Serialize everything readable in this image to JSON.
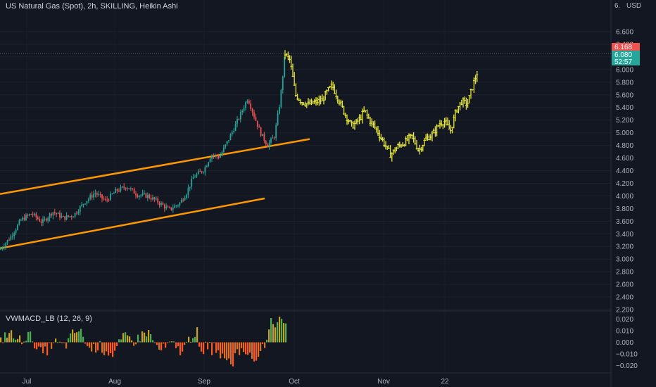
{
  "header": {
    "title": "US Natural Gas (Spot), 2h, SKILLING, Heikin Ashi",
    "currency": "USD",
    "top_price_partial": "6."
  },
  "price_tags": {
    "high": "6.168",
    "last": "6.080",
    "countdown": "52:57"
  },
  "indicator": {
    "label": "VWMACD_LB (12, 26, 9)"
  },
  "x_axis": [
    "Jul",
    "Aug",
    "Sep",
    "Oct",
    "Nov",
    "22"
  ],
  "colors": {
    "background": "#131722",
    "up": "#26a69a",
    "down": "#ef5350",
    "projection": "#e8e83a",
    "channel": "#ff9800",
    "hist_up": "#4caf50",
    "hist_down": "#ff5722",
    "hist_up_dim": "#c9a227",
    "hist_down_dim": "#e07020"
  },
  "chart_data": [
    {
      "type": "line",
      "title": "US Natural Gas (Spot), 2h, SKILLING, Heikin Ashi",
      "y_unit": "USD",
      "ylim": [
        2.2,
        6.6
      ],
      "yticks": [
        2.2,
        2.4,
        2.6,
        2.8,
        3.0,
        3.2,
        3.4,
        3.6,
        3.8,
        4.0,
        4.2,
        4.4,
        4.6,
        4.8,
        5.0,
        5.2,
        5.4,
        5.6,
        5.8,
        6.0,
        6.2,
        6.4,
        6.6
      ],
      "x_tick_labels": [
        "Jul",
        "Aug",
        "Sep",
        "Oct",
        "Nov",
        "22"
      ],
      "series": [
        {
          "kind": "candles",
          "points": [
            [
              0,
              3.15
            ],
            [
              15,
              3.35
            ],
            [
              30,
              3.62
            ],
            [
              45,
              3.72
            ],
            [
              60,
              3.58
            ],
            [
              75,
              3.75
            ],
            [
              90,
              3.65
            ],
            [
              105,
              3.7
            ],
            [
              120,
              3.9
            ],
            [
              135,
              4.05
            ],
            [
              150,
              3.92
            ],
            [
              165,
              4.08
            ],
            [
              180,
              4.15
            ],
            [
              195,
              4.02
            ],
            [
              210,
              4.0
            ],
            [
              225,
              3.9
            ],
            [
              240,
              3.78
            ],
            [
              255,
              3.88
            ],
            [
              265,
              4.05
            ],
            [
              275,
              4.3
            ],
            [
              290,
              4.42
            ],
            [
              300,
              4.65
            ],
            [
              312,
              4.62
            ],
            [
              325,
              4.9
            ],
            [
              340,
              5.25
            ],
            [
              352,
              5.55
            ],
            [
              360,
              5.3
            ],
            [
              370,
              5.0
            ],
            [
              380,
              4.8
            ],
            [
              390,
              4.95
            ],
            [
              398,
              5.5
            ],
            [
              405,
              6.25
            ]
          ]
        },
        {
          "kind": "projection",
          "points": [
            [
              405,
              6.25
            ],
            [
              412,
              6.15
            ],
            [
              420,
              5.6
            ],
            [
              428,
              5.5
            ],
            [
              438,
              5.45
            ],
            [
              448,
              5.48
            ],
            [
              458,
              5.52
            ],
            [
              465,
              5.65
            ],
            [
              472,
              5.75
            ],
            [
              480,
              5.55
            ],
            [
              490,
              5.3
            ],
            [
              500,
              5.1
            ],
            [
              510,
              5.2
            ],
            [
              518,
              5.35
            ],
            [
              525,
              5.2
            ],
            [
              535,
              5.05
            ],
            [
              545,
              4.85
            ],
            [
              555,
              4.65
            ],
            [
              565,
              4.78
            ],
            [
              575,
              4.85
            ],
            [
              585,
              4.95
            ],
            [
              595,
              4.72
            ],
            [
              605,
              4.9
            ],
            [
              615,
              4.98
            ],
            [
              625,
              5.15
            ],
            [
              632,
              5.18
            ],
            [
              640,
              5.02
            ],
            [
              648,
              5.35
            ],
            [
              656,
              5.5
            ],
            [
              664,
              5.45
            ],
            [
              672,
              5.75
            ],
            [
              678,
              5.95
            ]
          ]
        },
        {
          "kind": "channel_upper",
          "points": [
            [
              0,
              4.03
            ],
            [
              440,
              4.9
            ]
          ]
        },
        {
          "kind": "channel_lower",
          "points": [
            [
              0,
              3.17
            ],
            [
              376,
              3.96
            ]
          ]
        }
      ]
    },
    {
      "type": "bar",
      "title": "VWMACD_LB (12, 26, 9)",
      "ylim": [
        -0.025,
        0.025
      ],
      "yticks": [
        -0.02,
        -0.01,
        0.0,
        0.01,
        0.02
      ]
    }
  ]
}
